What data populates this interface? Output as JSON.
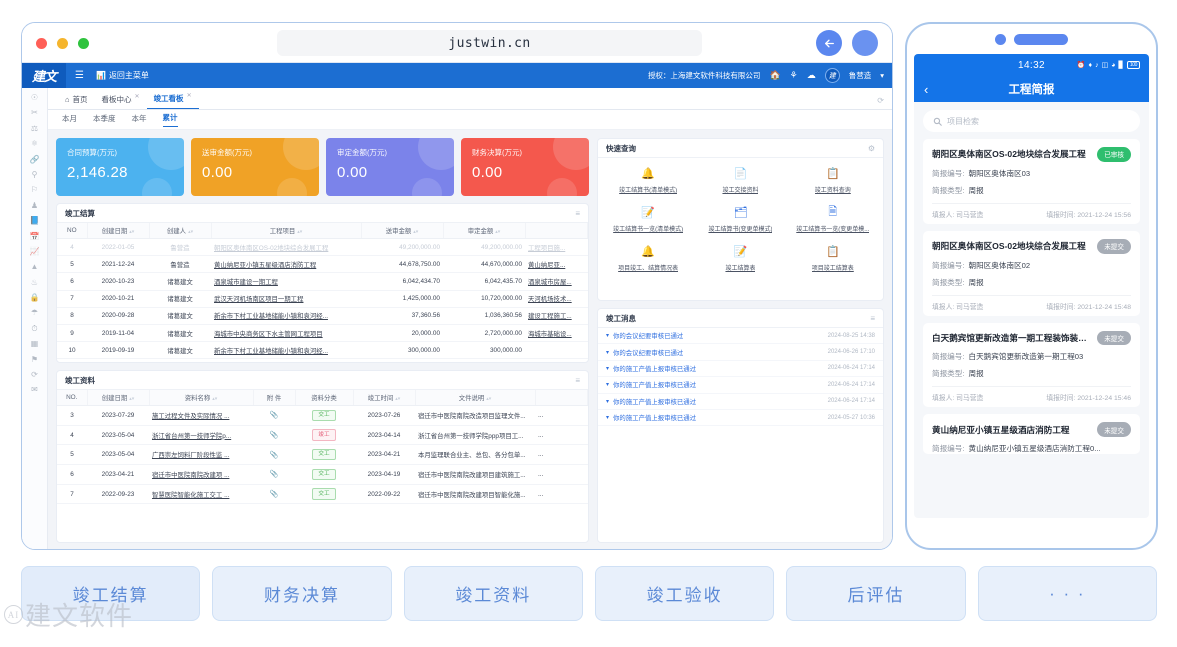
{
  "browser": {
    "url": "justwin.cn",
    "back_icon": "arrow-left-icon",
    "dots": [
      "close",
      "minimize",
      "maximize"
    ]
  },
  "app": {
    "logo": "建文",
    "menu_icon": "hamburger-icon",
    "back_to_menu": "返回主菜单",
    "license": "授权：上海建文软件科技有限公司",
    "user": "鲁营造",
    "header_icons": [
      "home-icon",
      "sitemap-icon",
      "cloud-icon"
    ],
    "rail_icons": [
      "globe-icon",
      "scissors-icon",
      "tower-icon",
      "shield-icon",
      "link-icon",
      "tree-icon",
      "flag-icon",
      "person-icon",
      "book-icon",
      "calendar-icon",
      "chart-icon",
      "cone-icon",
      "drop-icon",
      "lock-icon",
      "umbrella-icon",
      "clock-icon",
      "grid-icon",
      "pin-icon",
      "refresh-icon",
      "mail-icon"
    ],
    "tabs": [
      {
        "label": "首页",
        "icon": "home-icon",
        "closable": false,
        "active": false
      },
      {
        "label": "看板中心",
        "closable": true,
        "active": false
      },
      {
        "label": "竣工看板",
        "closable": true,
        "active": true
      }
    ],
    "refresh_icon": "refresh-icon",
    "filters": [
      {
        "label": "本月",
        "active": false
      },
      {
        "label": "本季度",
        "active": false
      },
      {
        "label": "本年",
        "active": false
      },
      {
        "label": "累计",
        "active": true
      }
    ],
    "kpis": [
      {
        "title": "合同预算(万元)",
        "value": "2,146.28",
        "color": "#4cb2ef"
      },
      {
        "title": "送审金额(万元)",
        "value": "0.00",
        "color": "#f0a226"
      },
      {
        "title": "审定金额(万元)",
        "value": "0.00",
        "color": "#7b83ea"
      },
      {
        "title": "财务决算(万元)",
        "value": "0.00",
        "color": "#f4584d"
      }
    ],
    "settlement_panel": {
      "title": "竣工结算",
      "tool_icon": "list-menu-icon",
      "columns": [
        "NO",
        "创建日期",
        "创建人",
        "工程项目",
        "送审金额",
        "审定金额",
        ""
      ],
      "rows": [
        {
          "faded": true,
          "cells": [
            "4",
            "2022-01-05",
            "鲁营造",
            "朝阳区奥体南区OS-02地块综合发展工程",
            "49,200,000.00",
            "49,200,000.00",
            "工程项目施..."
          ]
        },
        {
          "faded": false,
          "cells": [
            "5",
            "2021-12-24",
            "鲁营造",
            "黄山纳尼亚小镇五星级酒店消防工程",
            "44,678,750.00",
            "44,670,000.00",
            "黄山纳尼亚..."
          ]
        },
        {
          "faded": false,
          "cells": [
            "6",
            "2020-10-23",
            "诸葛建文",
            "酒泉城市建设一期工程",
            "6,042,434.70",
            "6,042,435.70",
            "酒泉城市房屋..."
          ]
        },
        {
          "faded": false,
          "cells": [
            "7",
            "2020-10-21",
            "诸葛建文",
            "武汉天河机场南区项目一期工程",
            "1,425,000.00",
            "10,720,000.00",
            "天河机场技术..."
          ]
        },
        {
          "faded": false,
          "cells": [
            "8",
            "2020-09-28",
            "诸葛建文",
            "新余市下村工业基地储能小镇和袁河经...",
            "37,360.56",
            "1,036,360.56",
            "建设工程施工..."
          ]
        },
        {
          "faded": false,
          "cells": [
            "9",
            "2019-11-04",
            "诸葛建文",
            "海城市中央商务区下水主管网工程项目",
            "20,000.00",
            "2,720,000.00",
            "海城市基础设..."
          ]
        },
        {
          "faded": false,
          "cells": [
            "10",
            "2019-09-19",
            "诸葛建文",
            "新余市下村工业基地储能小镇和袁河经...",
            "300,000.00",
            "300,000.00",
            ""
          ]
        }
      ]
    },
    "documents_panel": {
      "title": "竣工资料",
      "tool_icon": "list-menu-icon",
      "columns": [
        "NO.",
        "创建日期",
        "资料名称",
        "附 件",
        "资料分类",
        "竣工时间",
        "文件说明",
        ""
      ],
      "rows": [
        {
          "no": "3",
          "date": "2023-07-29",
          "name": "施工过程文件及实际情况 ...",
          "attach": "paperclip-icon",
          "tag": "交工",
          "tag_color": "green",
          "done": "2023-07-26",
          "desc": "宿迁市中医院南院改造项目监理文件...",
          "extra": "..."
        },
        {
          "no": "4",
          "date": "2023-05-04",
          "name": "浙江省台州第一技师学院p...",
          "attach": "paperclip-icon",
          "tag": "竣工",
          "tag_color": "red",
          "done": "2023-04-14",
          "desc": "浙江省台州第一技师学院ppp项目工...",
          "extra": "..."
        },
        {
          "no": "5",
          "date": "2023-05-04",
          "name": "广西崇左饲料厂阶段性监 ...",
          "attach": "paperclip-icon",
          "tag": "交工",
          "tag_color": "green",
          "done": "2023-04-21",
          "desc": "本月监理联合业主、总包、各分包单...",
          "extra": "..."
        },
        {
          "no": "6",
          "date": "2023-04-21",
          "name": "宿迁市中医院南院改建项 ...",
          "attach": "paperclip-icon",
          "tag": "交工",
          "tag_color": "green",
          "done": "2023-04-19",
          "desc": "宿迁市中医院南院改建项目建筑施工...",
          "extra": "..."
        },
        {
          "no": "7",
          "date": "2022-09-23",
          "name": "智慧医院智能化施工交工 ...",
          "attach": "paperclip-icon",
          "tag": "交工",
          "tag_color": "green",
          "done": "2022-09-22",
          "desc": "宿迁市中医院南院改建项目智能化施...",
          "extra": "..."
        }
      ]
    },
    "quick_query": {
      "title": "快速查询",
      "tool_icon": "gear-icon",
      "items": [
        {
          "label": "竣工结算书(清单模式)",
          "icon": "bell-icon"
        },
        {
          "label": "竣工交接资料",
          "icon": "document-icon"
        },
        {
          "label": "竣工资料查询",
          "icon": "clipboard-icon"
        },
        {
          "label": "竣工结算书一览(清单模式)",
          "icon": "clipboard-check-icon"
        },
        {
          "label": "竣工结算书(变更单模式)",
          "icon": "folder-icon"
        },
        {
          "label": "竣工结算书一览(变更单模...",
          "icon": "table-icon"
        },
        {
          "label": "项目竣工、结算情况表",
          "icon": "bell-icon"
        },
        {
          "label": "竣工结算表",
          "icon": "clipboard-check-icon"
        },
        {
          "label": "项目竣工结算表",
          "icon": "clipboard-icon"
        }
      ]
    },
    "messages": {
      "title": "竣工消息",
      "tool_icon": "list-menu-icon",
      "items": [
        {
          "text": "你的会议纪要审核已通过",
          "time": "2024-08-25 14:38"
        },
        {
          "text": "你的会议纪要审核已通过",
          "time": "2024-06-26 17:10"
        },
        {
          "text": "你的施工产值上报审核已通过",
          "time": "2024-06-24 17:14"
        },
        {
          "text": "你的施工产值上报审核已通过",
          "time": "2024-06-24 17:14"
        },
        {
          "text": "你的施工产值上报审核已通过",
          "time": "2024-06-24 17:14"
        },
        {
          "text": "你的施工产值上报审核已通过",
          "time": "2024-05-27 10:36"
        }
      ]
    }
  },
  "phone": {
    "status": {
      "time": "14:32",
      "battery": "100",
      "icons": [
        "alarm-off-icon",
        "bluetooth-icon",
        "vibrate-icon",
        "sim-icon",
        "wifi-icon",
        "signal-icon"
      ]
    },
    "nav": {
      "back_icon": "chevron-left-icon",
      "title": "工程简报"
    },
    "search": {
      "placeholder": "项目检索",
      "icon": "search-icon"
    },
    "cards": [
      {
        "name": "朝阳区奥体南区OS-02地块综合发展工程",
        "status": "已审核",
        "status_color": "green",
        "no_label": "简报编号:",
        "no_value": "朝阳区奥体南区03",
        "type_label": "简报类型:",
        "type_value": "周报",
        "filler_label": "填报人:",
        "filler_value": "司马营造",
        "time_label": "填报时间:",
        "time_value": "2021-12-24 15:56"
      },
      {
        "name": "朝阳区奥体南区OS-02地块综合发展工程",
        "status": "未提交",
        "status_color": "gray",
        "no_label": "简报编号:",
        "no_value": "朝阳区奥体南区02",
        "type_label": "简报类型:",
        "type_value": "周报",
        "filler_label": "填报人:",
        "filler_value": "司马营造",
        "time_label": "填报时间:",
        "time_value": "2021-12-24 15:48"
      },
      {
        "name": "白天鹅宾馆更新改造第一期工程装饰装…",
        "status": "未提交",
        "status_color": "gray",
        "no_label": "简报编号:",
        "no_value": "白天鹅宾馆更新改造第一期工程03",
        "type_label": "简报类型:",
        "type_value": "周报",
        "filler_label": "填报人:",
        "filler_value": "司马营造",
        "time_label": "填报时间:",
        "time_value": "2021-12-24 15:46"
      },
      {
        "name": "黄山纳尼亚小镇五星级酒店消防工程",
        "status": "未提交",
        "status_color": "gray",
        "no_label": "简报编号:",
        "no_value": "黄山纳尼亚小镇五星级酒店消防工程0...",
        "type_label": "",
        "type_value": "",
        "filler_label": "",
        "filler_value": "",
        "time_label": "",
        "time_value": ""
      }
    ]
  },
  "bottom_buttons": [
    {
      "label": "竣工结算"
    },
    {
      "label": "财务决算"
    },
    {
      "label": "竣工资料"
    },
    {
      "label": "竣工验收"
    },
    {
      "label": "后评估"
    },
    {
      "label": "· · ·"
    }
  ],
  "watermark": {
    "mark": "AI",
    "text": "建文软件"
  }
}
